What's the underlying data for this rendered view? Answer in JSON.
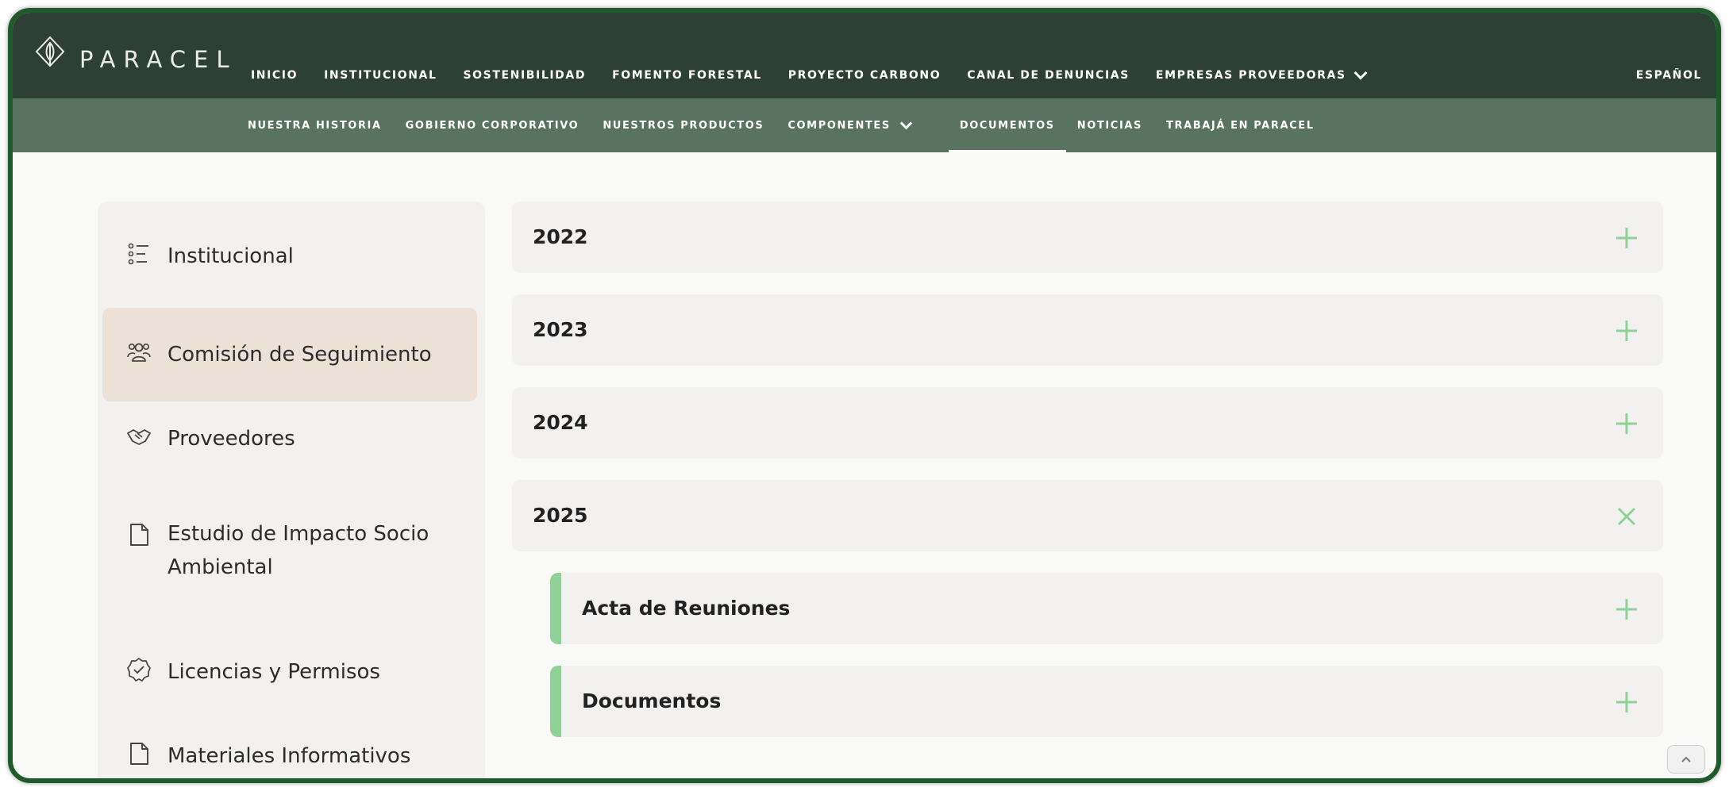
{
  "brand": {
    "name": "PARACEL"
  },
  "top_nav": {
    "items": [
      "INICIO",
      "INSTITUCIONAL",
      "SOSTENIBILIDAD",
      "FOMENTO FORESTAL",
      "PROYECTO CARBONO",
      "CANAL DE DENUNCIAS",
      "EMPRESAS PROVEEDORAS"
    ],
    "language": "ESPAÑOL"
  },
  "sub_nav": {
    "items": [
      "NUESTRA HISTORIA",
      "GOBIERNO CORPORATIVO",
      "NUESTROS PRODUCTOS",
      "COMPONENTES",
      "DOCUMENTOS",
      "NOTICIAS",
      "TRABAJÁ EN PARACEL"
    ],
    "active": "DOCUMENTOS"
  },
  "sidebar": {
    "items": [
      {
        "label": "Institucional",
        "icon": "list-icon"
      },
      {
        "label": "Comisión de Seguimiento",
        "icon": "people-icon",
        "active": true
      },
      {
        "label": "Proveedores",
        "icon": "handshake-icon"
      },
      {
        "label": "Estudio de Impacto Socio Ambiental",
        "line1": "Estudio de Impacto Socio",
        "line2": "Ambiental",
        "icon": "document-icon"
      },
      {
        "label": "Licencias y Permisos",
        "icon": "badge-check-icon"
      },
      {
        "label": "Materiales Informativos",
        "icon": "document-icon"
      }
    ]
  },
  "accordions": [
    {
      "title": "2022",
      "state": "collapsed"
    },
    {
      "title": "2023",
      "state": "collapsed"
    },
    {
      "title": "2024",
      "state": "collapsed"
    },
    {
      "title": "2025",
      "state": "expanded"
    }
  ],
  "sub_accordions": [
    {
      "title": "Acta de Reuniones",
      "state": "collapsed"
    },
    {
      "title": "Documentos",
      "state": "collapsed"
    }
  ],
  "colors": {
    "topbar": "#2e3f36",
    "subbar": "#58735f",
    "accent_green": "#8fd197",
    "active_item_bg": "#ebe1d6",
    "frame_border": "#1f5a2a"
  }
}
